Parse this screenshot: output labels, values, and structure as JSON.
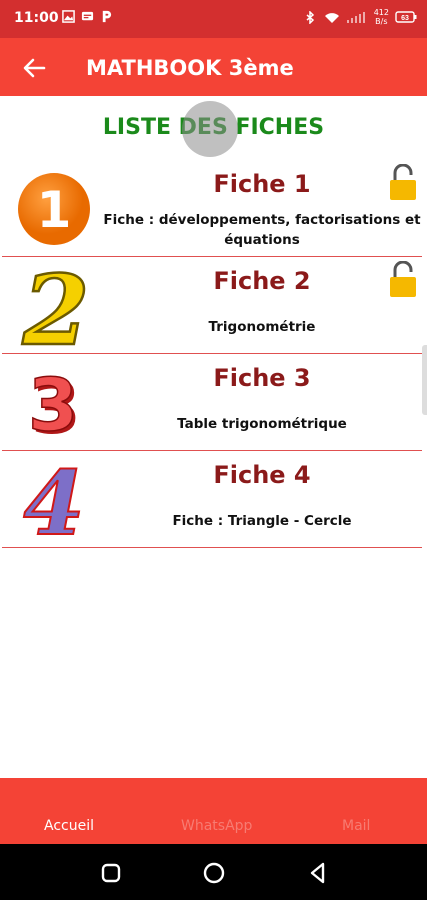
{
  "status_bar": {
    "time": "11:00",
    "net_speed_top": "412",
    "net_speed_bottom": "B/s",
    "battery": "63"
  },
  "app_bar": {
    "title": "MATHBOOK 3ème"
  },
  "list": {
    "heading": "LISTE DES FICHES",
    "items": [
      {
        "number": "1",
        "title": "Fiche 1",
        "desc_line1": "Fiche : développements, factorisations et",
        "desc_line2": "équations",
        "locked_icon": "unlocked-padlock-icon"
      },
      {
        "number": "2",
        "title": "Fiche 2",
        "desc_line1": "Trigonométrie",
        "locked_icon": "unlocked-padlock-icon"
      },
      {
        "number": "3",
        "title": "Fiche 3",
        "desc_line1": "Table trigonométrique"
      },
      {
        "number": "4",
        "title": "Fiche 4",
        "desc_line1": "Fiche : Triangle - Cercle"
      }
    ]
  },
  "bottom_nav": {
    "home": "Accueil",
    "whatsapp": "WhatsApp",
    "mail": "Mail"
  },
  "colors": {
    "status_bar": "#d32f2f",
    "app_bar": "#f44336",
    "heading": "#1b8a1b",
    "item_title": "#8b1a1a",
    "divider": "#e05050",
    "lock": "#f5b800"
  }
}
